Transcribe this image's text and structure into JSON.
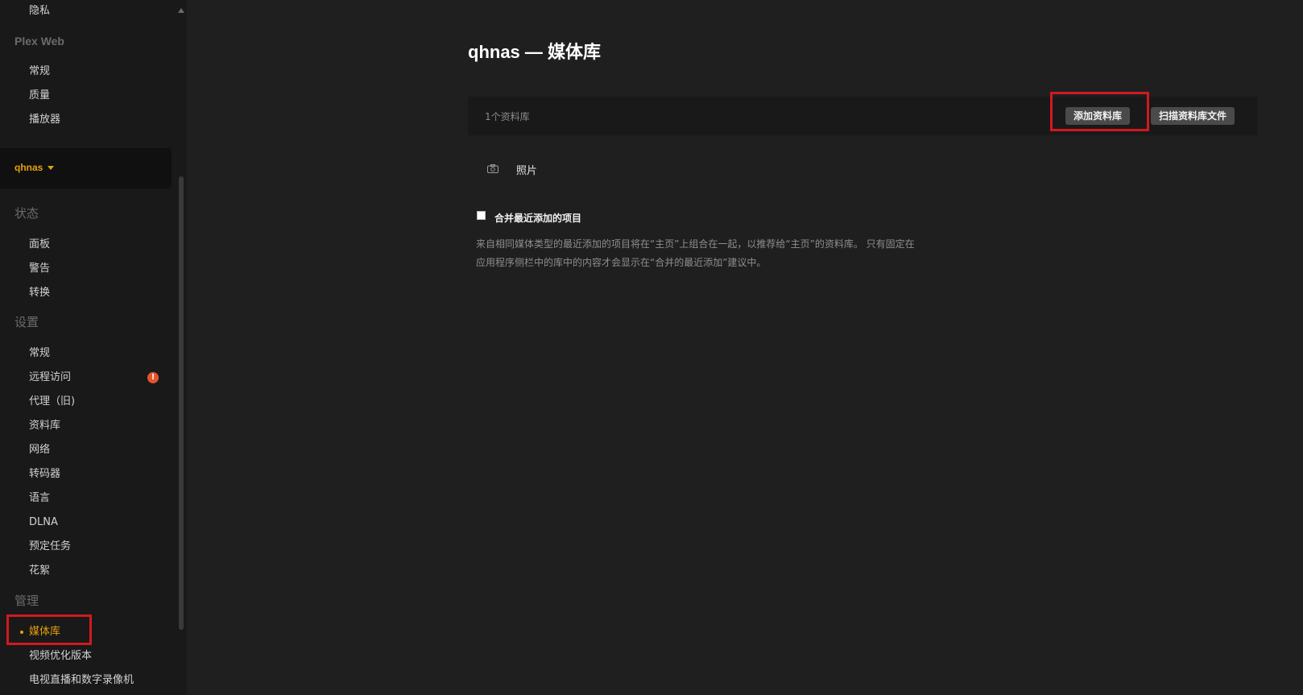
{
  "sidebar": {
    "top_item": "隐私",
    "plex_web": {
      "title": "Plex Web",
      "items": [
        "常规",
        "质量",
        "播放器"
      ]
    },
    "server": {
      "name": "qhnas"
    },
    "status": {
      "title": "状态",
      "items": [
        "面板",
        "警告",
        "转换"
      ]
    },
    "settings": {
      "title": "设置",
      "items": [
        "常规",
        "远程访问",
        "代理（旧)",
        "资料库",
        "网络",
        "转码器",
        "语言",
        "DLNA",
        "预定任务",
        "花絮"
      ],
      "alert_badge": "!"
    },
    "manage": {
      "title": "管理",
      "items": [
        "媒体库",
        "视频优化版本",
        "电视直播和数字录像机"
      ]
    }
  },
  "colors": {
    "accent": "#e5a00d",
    "alert": "#e5552b",
    "highlight_box": "#d1191f"
  },
  "main": {
    "title": "qhnas — 媒体库",
    "library_bar": {
      "count": "1个资料库",
      "add_button": "添加资料库",
      "scan_button": "扫描资料库文件"
    },
    "libraries": [
      {
        "icon": "camera-icon",
        "name": "照片"
      }
    ],
    "merge_option": {
      "label": "合并最近添加的项目",
      "checked": false,
      "help_line1": "来自相同媒体类型的最近添加的项目将在“主页”上组合在一起，以推荐给“主页”的资料库。 只有固定在",
      "help_line2": "应用程序侧栏中的库中的内容才会显示在“合并的最近添加”建议中。"
    }
  }
}
